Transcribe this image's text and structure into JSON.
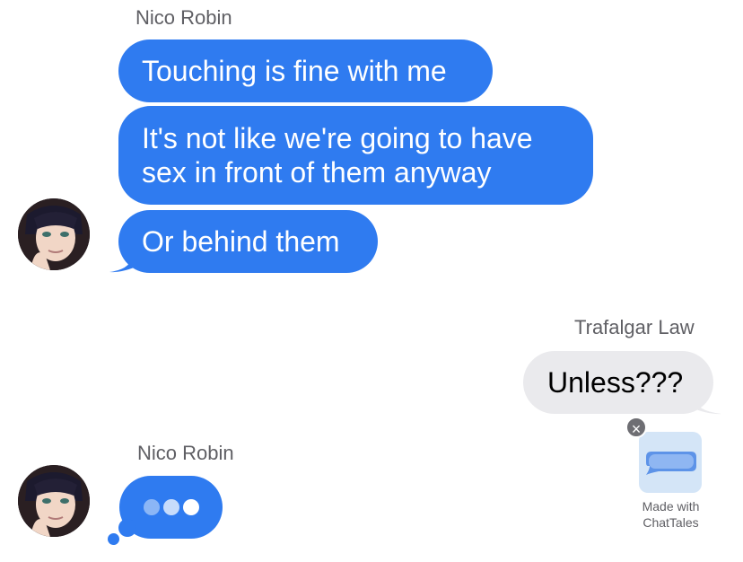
{
  "conversation": {
    "group1": {
      "sender": "Nico Robin",
      "messages": [
        "Touching is fine with me",
        "It's not like we're going to have",
        "sex in front of them anyway",
        "Or behind them"
      ]
    },
    "group2": {
      "sender": "Trafalgar Law",
      "message": "Unless???"
    },
    "group3": {
      "sender": "Nico Robin",
      "typing": true
    }
  },
  "badge": {
    "line1": "Made with",
    "line2": "ChatTales"
  },
  "colors": {
    "outgoing_bubble": "#2f7bf0",
    "incoming_bubble": "#eaeaed",
    "sender_text": "#5f5f64"
  },
  "icons": [
    "avatar-nico-robin",
    "close-icon",
    "chat-bubble-icon"
  ]
}
